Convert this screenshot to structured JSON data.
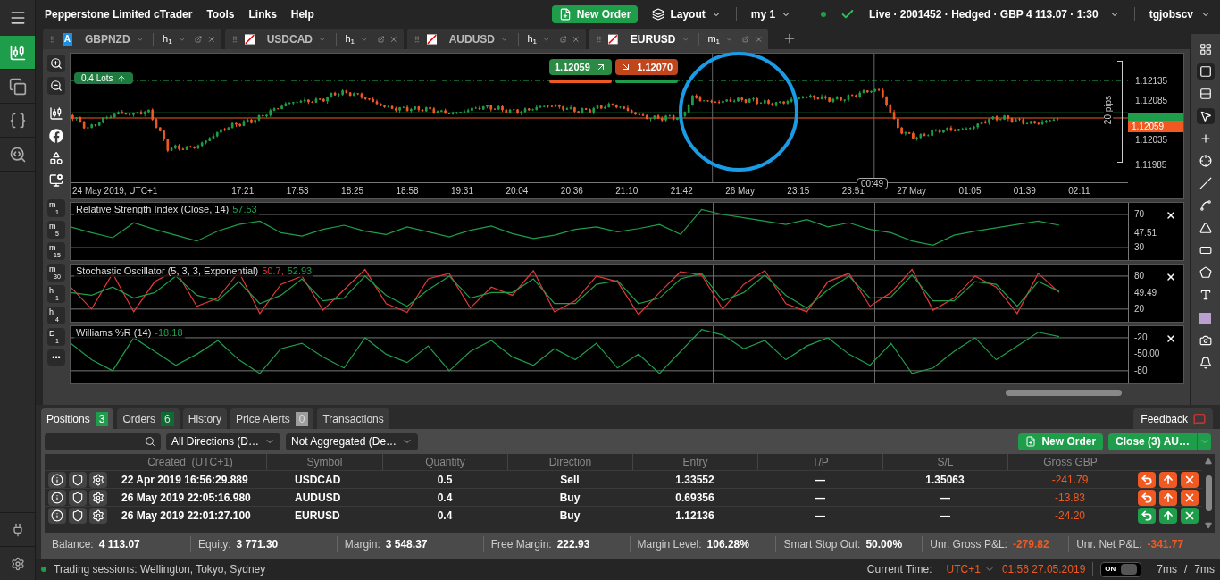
{
  "app_menu": {
    "title": "Pepperstone Limited cTrader",
    "items": [
      "Tools",
      "Links",
      "Help"
    ]
  },
  "header": {
    "new_order": "New Order",
    "layout": "Layout",
    "workspace": "my 1",
    "account": "Live · 2001452 · Hedged · GBP 4 113.07 · 1:30",
    "user": "tgjobscv"
  },
  "sidebar": {
    "items": [
      {
        "kind": "chart",
        "selected": true
      },
      {
        "kind": "copy",
        "selected": false
      },
      {
        "kind": "code",
        "selected": false
      },
      {
        "kind": "analysis",
        "selected": false
      }
    ]
  },
  "chart_tabs": [
    {
      "badge": "A",
      "symbol": "GBPNZD",
      "timeframe": "h",
      "period": "1",
      "selected": false
    },
    {
      "symbol": "USDCAD",
      "timeframe": "h",
      "period": "1",
      "selected": false
    },
    {
      "symbol": "AUDUSD",
      "timeframe": "h",
      "period": "1",
      "selected": false
    },
    {
      "symbol": "EURUSD",
      "timeframe": "m",
      "period": "1",
      "selected": true
    }
  ],
  "chart": {
    "lots": "0.4 Lots",
    "sell_price": "1.12059",
    "buy_price": "1.12070",
    "price_labels": [
      "1.12135",
      "1.12085",
      "1.12035",
      "1.11985"
    ],
    "bid_label": "1.12059",
    "range_label": "20 pips",
    "time_labels": [
      "24 May 2019, UTC+1",
      "17:21",
      "17:53",
      "18:25",
      "18:58",
      "19:31",
      "20:04",
      "20:36",
      "21:10",
      "21:42",
      "26 May",
      "23:15",
      "23:51",
      "27 May",
      "01:05",
      "01:39",
      "02:11"
    ],
    "cursor_time": "00:49"
  },
  "timeframes": [
    {
      "unit": "m",
      "value": "1"
    },
    {
      "unit": "m",
      "value": "5"
    },
    {
      "unit": "m",
      "value": "15"
    },
    {
      "unit": "m",
      "value": "30"
    },
    {
      "unit": "h",
      "value": "1"
    },
    {
      "unit": "h",
      "value": "4"
    },
    {
      "unit": "D",
      "value": "1"
    }
  ],
  "timeframes_more": "•••",
  "indicators": [
    {
      "title": "Relative Strength Index (Close, 14)",
      "readings": [
        {
          "text": "57.53",
          "color": "#1e9e4a"
        }
      ],
      "chart_data": {
        "type": "line",
        "ylim": [
          15,
          84
        ],
        "yticks": [
          {
            "value": 70,
            "label": "70"
          },
          {
            "value": 47.51,
            "label": "47.51"
          },
          {
            "value": 30,
            "label": "30"
          }
        ],
        "series": [
          {
            "color": "#1e9e4a",
            "values": [
              55,
              48,
              42,
              60,
              52,
              45,
              38,
              50,
              58,
              62,
              48,
              44,
              52,
              57,
              50,
              46,
              55,
              49,
              43,
              51,
              56,
              47,
              41,
              45,
              52,
              55,
              49,
              53,
              58,
              46,
              76,
              70,
              66,
              62,
              58,
              64,
              55,
              60,
              52,
              48,
              38,
              33,
              45,
              50,
              54,
              58,
              62,
              57
            ]
          }
        ]
      }
    },
    {
      "title": "Stochastic Oscillator (5, 3, 3, Exponential)",
      "readings": [
        {
          "text": "50.7,",
          "color": "#e53935"
        },
        {
          "text": "52.93",
          "color": "#1e9e4a"
        }
      ],
      "chart_data": {
        "type": "line",
        "ylim": [
          -3,
          101
        ],
        "yticks": [
          {
            "value": 80,
            "label": "80"
          },
          {
            "value": 49.49,
            "label": "49.49"
          },
          {
            "value": 20,
            "label": "20"
          }
        ],
        "series": [
          {
            "color": "#e53935",
            "values": [
              60,
              20,
              85,
              15,
              70,
              90,
              25,
              40,
              88,
              12,
              65,
              80,
              18,
              55,
              92,
              30,
              14,
              75,
              85,
              22,
              60,
              45,
              90,
              15,
              35,
              80,
              70,
              10,
              50,
              88,
              82,
              20,
              65,
              90,
              30,
              15,
              70,
              85,
              25,
              50,
              92,
              18,
              40,
              80,
              60,
              12,
              85,
              50
            ]
          },
          {
            "color": "#1e9e4a",
            "values": [
              50,
              45,
              60,
              40,
              50,
              80,
              45,
              35,
              70,
              30,
              45,
              75,
              35,
              40,
              80,
              45,
              25,
              55,
              80,
              40,
              50,
              50,
              75,
              30,
              30,
              65,
              72,
              30,
              40,
              75,
              85,
              35,
              50,
              82,
              45,
              22,
              55,
              80,
              40,
              42,
              82,
              35,
              35,
              70,
              65,
              25,
              70,
              52
            ]
          }
        ]
      }
    },
    {
      "title": "Williams %R (14)",
      "readings": [
        {
          "text": "-18.18",
          "color": "#1e9e4a"
        }
      ],
      "chart_data": {
        "type": "line",
        "ylim": [
          -103,
          1
        ],
        "yticks": [
          {
            "value": -20,
            "label": "-20"
          },
          {
            "value": -50,
            "label": "-50.00"
          },
          {
            "value": -80,
            "label": "-80"
          }
        ],
        "series": [
          {
            "color": "#1e9e4a",
            "values": [
              -30,
              -60,
              -80,
              -20,
              -45,
              -70,
              -50,
              -25,
              -60,
              -85,
              -40,
              -30,
              -55,
              -75,
              -20,
              -50,
              -65,
              -35,
              -80,
              -45,
              -25,
              -55,
              -70,
              -40,
              -60,
              -30,
              -75,
              -50,
              -85,
              -45,
              -5,
              -15,
              -40,
              -25,
              -60,
              -35,
              -20,
              -50,
              -70,
              -30,
              -85,
              -75,
              -45,
              -20,
              -60,
              -35,
              -10,
              -18
            ]
          }
        ]
      }
    }
  ],
  "bottom_tabs": [
    {
      "label": "Positions",
      "count": "3",
      "color": "#1e9e4a",
      "selected": true
    },
    {
      "label": "Orders",
      "count": "6",
      "color": "#0f6b34",
      "selected": false
    },
    {
      "label": "History",
      "selected": false
    },
    {
      "label": "Price Alerts",
      "count": "0",
      "color": "#9e9e9e",
      "selected": false
    },
    {
      "label": "Transactions",
      "selected": false
    }
  ],
  "feedback": "Feedback",
  "filters": {
    "direction": "All Directions (D…",
    "aggregation": "Not Aggregated (De…"
  },
  "actions": {
    "new_order": "New Order",
    "close": "Close (3) AU…"
  },
  "positions": {
    "columns": [
      "Created  (UTC+1)",
      "Symbol",
      "Quantity",
      "Direction",
      "Entry",
      "T/P",
      "S/L",
      "Gross GBP"
    ],
    "rows": [
      {
        "created": "22 Apr 2019 16:56:29.889",
        "symbol": "USDCAD",
        "quantity": "0.5",
        "direction": "Sell",
        "entry": "1.33552",
        "tp": "—",
        "sl": "1.35063",
        "gross": "-241.79",
        "color": "#f05a22"
      },
      {
        "created": "26 May 2019 22:05:16.980",
        "symbol": "AUDUSD",
        "quantity": "0.4",
        "direction": "Buy",
        "entry": "0.69356",
        "tp": "—",
        "sl": "—",
        "gross": "-13.83",
        "color": "#f05a22"
      },
      {
        "created": "26 May 2019 22:01:27.100",
        "symbol": "EURUSD",
        "quantity": "0.4",
        "direction": "Buy",
        "entry": "1.12136",
        "tp": "—",
        "sl": "—",
        "gross": "-24.20",
        "color": "#1e9e4a"
      }
    ]
  },
  "summary": [
    {
      "label": "Balance:",
      "value": "4 113.07",
      "color": "#ffffff"
    },
    {
      "label": "Equity:",
      "value": "3 771.30",
      "color": "#ffffff"
    },
    {
      "label": "Margin:",
      "value": "3 548.37",
      "color": "#ffffff"
    },
    {
      "label": "Free Margin:",
      "value": "222.93",
      "color": "#ffffff"
    },
    {
      "label": "Margin Level:",
      "value": "106.28%",
      "color": "#ffffff"
    },
    {
      "label": "Smart Stop Out:",
      "value": "50.00%",
      "color": "#ffffff"
    },
    {
      "label": "Unr. Gross P&L:",
      "value": "-279.82",
      "color": "#f05a22"
    },
    {
      "label": "Unr. Net P&L:",
      "value": "-341.77",
      "color": "#f05a22"
    }
  ],
  "status_bar": {
    "sessions": "Trading sessions: Wellington, Tokyo, Sydney",
    "time_label": "Current Time:",
    "timezone": "UTC+1",
    "time": "01:56 27.05.2019",
    "toggle": {
      "label": "ON",
      "on": true
    },
    "latency": [
      "7ms",
      "7ms"
    ],
    "separator": "/"
  }
}
